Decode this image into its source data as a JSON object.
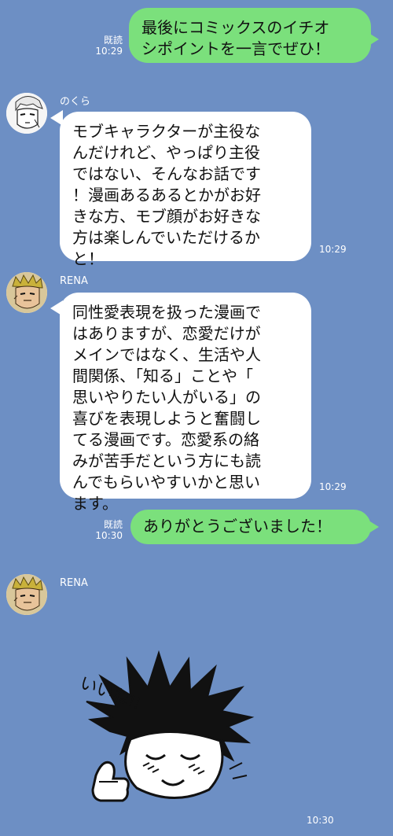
{
  "messages": [
    {
      "read_label": "既読",
      "time": "10:29",
      "text": "最後にコミックスのイチオ\nシポイントを一言でぜひ！"
    },
    {
      "sender": "のくら",
      "time": "10:29",
      "text": "モブキャラクターが主役な\nんだけれど、やっぱり主役\nではない、そんなお話です\n！漫画あるあるとかがお好\nきな方、モブ顔がお好きな\n方は楽しんでいただけるか\nと！"
    },
    {
      "sender": "RENA",
      "time": "10:29",
      "text": "同性愛表現を扱った漫画で\nはありますが、恋愛だけが\nメインではなく、生活や人\n間関係、「知る」ことや「\n思いやりたい人がいる」の\n喜びを表現しようと奮闘し\nてる漫画です。恋愛系の絡\nみが苦手だという方にも読\nんでもらいやすいかと思い\nます。"
    },
    {
      "read_label": "既読",
      "time": "10:30",
      "text": "ありがとうございました！"
    },
    {
      "sender": "RENA",
      "time": "10:30",
      "sticker_text": "いいね!!"
    }
  ]
}
